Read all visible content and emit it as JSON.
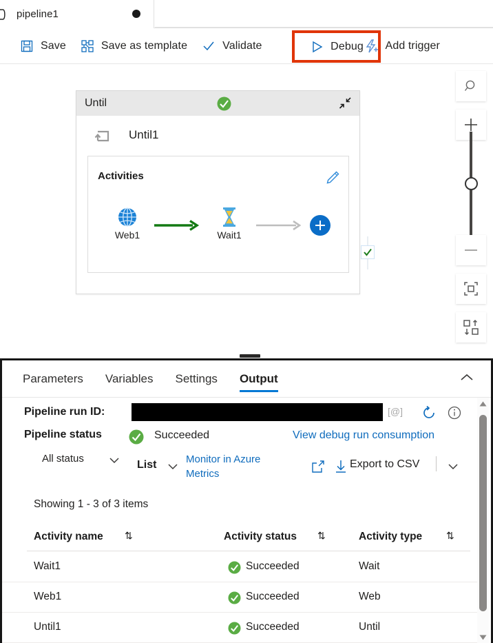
{
  "tab": {
    "icon": "pipeline-icon",
    "label": "pipeline1",
    "dirty_indicator": "unsaved-dot"
  },
  "toolbar": {
    "save_label": "Save",
    "save_as_template_label": "Save as template",
    "validate_label": "Validate",
    "debug_label": "Debug",
    "add_trigger_label": "Add trigger",
    "highlight_color": "#e03508"
  },
  "canvas": {
    "until_container": {
      "header_title": "Until",
      "status_icon": "success-check-icon",
      "collapse_icon": "collapse-icon",
      "node_name": "Until1",
      "node_icon": "until-loop-icon",
      "activities_label": "Activities",
      "edit_icon": "pencil-icon",
      "activities": [
        {
          "name": "Web1",
          "icon": "web-globe-icon"
        },
        {
          "name": "Wait1",
          "icon": "hourglass-icon"
        }
      ],
      "connectors": [
        {
          "from": "Web1",
          "to": "Wait1",
          "color": "#107c10"
        },
        {
          "from": "Wait1",
          "to": "add",
          "color": "#bdbdbd"
        }
      ],
      "add_activity_icon": "add-activity-icon",
      "edge_status_icon": "success-check-icon"
    },
    "zoom_controls": [
      {
        "name": "search-icon"
      },
      {
        "name": "zoom-in-icon"
      },
      {
        "name": "zoom-out-icon"
      },
      {
        "name": "fit-to-screen-icon"
      },
      {
        "name": "auto-layout-icon"
      }
    ]
  },
  "output_panel": {
    "tabs": [
      {
        "label": "Parameters",
        "selected": false
      },
      {
        "label": "Variables",
        "selected": false
      },
      {
        "label": "Settings",
        "selected": false
      },
      {
        "label": "Output",
        "selected": true
      }
    ],
    "collapse_icon": "chevron-up-icon",
    "run_id_label": "Pipeline run ID:",
    "run_id_value": "",
    "at_icon": "[@]",
    "refresh_icon": "refresh-icon",
    "info_icon": "info-icon",
    "status_label": "Pipeline status",
    "status_value": "Succeeded",
    "status_icon": "success-check-icon",
    "consumption_link": "View debug run consumption",
    "status_filter": "All status",
    "view_mode": "List",
    "monitor_link": "Monitor in Azure Metrics",
    "export_label": "Export to CSV",
    "open_new_icon": "open-in-new-icon",
    "download_icon": "download-icon",
    "showing_text": "Showing 1 - 3 of 3 items",
    "columns": [
      {
        "label": "Activity name",
        "sort_icon": "sort-icon"
      },
      {
        "label": "Activity status",
        "sort_icon": "sort-icon"
      },
      {
        "label": "Activity type",
        "sort_icon": "sort-icon"
      }
    ],
    "rows": [
      {
        "name": "Wait1",
        "status": "Succeeded",
        "type": "Wait",
        "status_icon": "success-check-icon"
      },
      {
        "name": "Web1",
        "status": "Succeeded",
        "type": "Web",
        "status_icon": "success-check-icon"
      },
      {
        "name": "Until1",
        "status": "Succeeded",
        "type": "Until",
        "status_icon": "success-check-icon"
      }
    ],
    "scrollbar": {
      "up_icon": "scroll-up-icon",
      "down_icon": "scroll-down-icon"
    }
  },
  "colors": {
    "success_green": "#5aac44",
    "link_blue": "#0f6cbd",
    "accent_blue": "#0078d4",
    "connector_green": "#107c10",
    "highlight_red": "#e03508"
  }
}
